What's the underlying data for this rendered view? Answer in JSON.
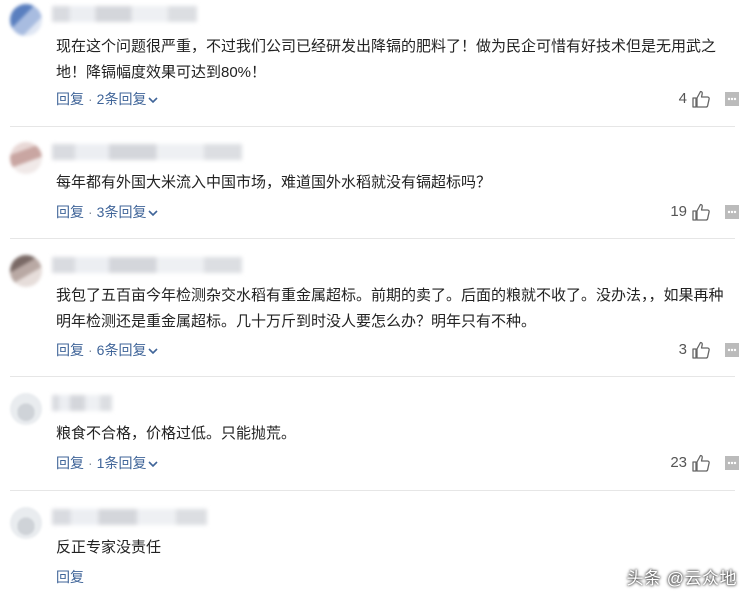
{
  "comments": [
    {
      "text": "现在这个问题很严重，不过我们公司已经研发出降镉的肥料了！做为民企可惜有好技术但是无用武之地！降镉幅度效果可达到80%！",
      "reply_label": "回复",
      "sep": "·",
      "replies_label": "2条回复",
      "likes": "4"
    },
    {
      "text": "每年都有外国大米流入中国市场，难道国外水稻就没有镉超标吗？",
      "reply_label": "回复",
      "sep": "·",
      "replies_label": "3条回复",
      "likes": "19"
    },
    {
      "text": "我包了五百亩今年检测杂交水稻有重金属超标。前期的卖了。后面的粮就不收了。没办法，，如果再种明年检测还是重金属超标。几十万斤到时没人要怎么办？明年只有不种。",
      "reply_label": "回复",
      "sep": "·",
      "replies_label": "6条回复",
      "likes": "3"
    },
    {
      "text": "粮食不合格，价格过低。只能抛荒。",
      "reply_label": "回复",
      "sep": "·",
      "replies_label": "1条回复",
      "likes": "23"
    },
    {
      "text": "反正专家没责任",
      "reply_label": "回复"
    }
  ],
  "watermark": "头条 @云众地",
  "icons": {
    "like": "thumbs-up-icon",
    "more": "more-icon",
    "expand": "chevron-down-icon"
  },
  "colors": {
    "link": "#406599",
    "text": "#222222",
    "divider": "#e6e6e6"
  }
}
